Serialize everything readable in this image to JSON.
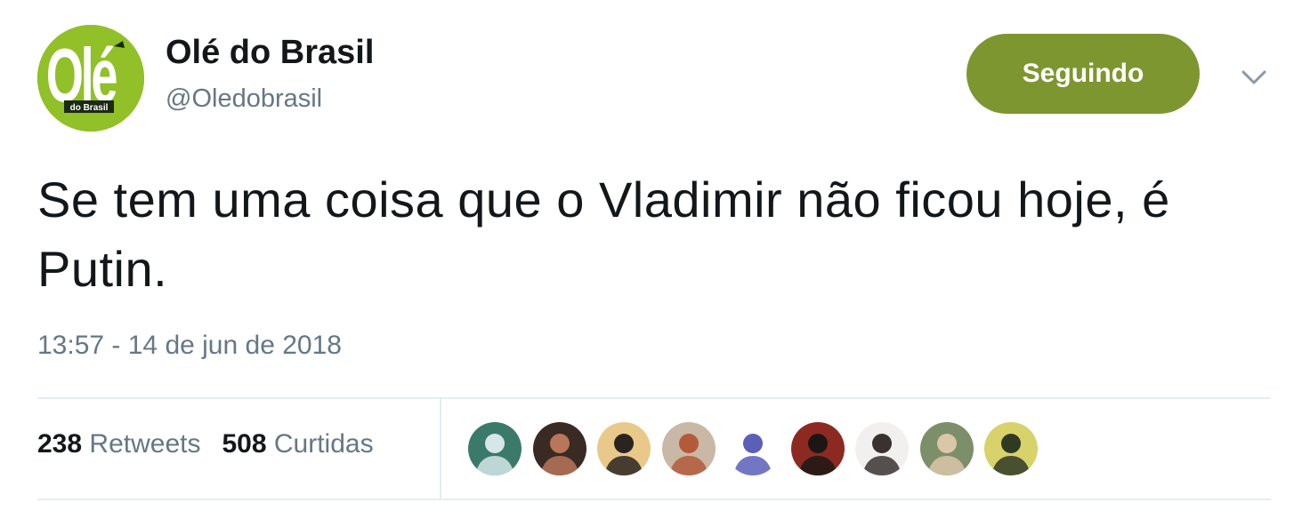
{
  "author": {
    "display_name": "Olé do Brasil",
    "handle": "@Oledobrasil",
    "avatar_text": "Olé",
    "avatar_subtext": "do Brasil"
  },
  "follow_button": {
    "label": "Seguindo"
  },
  "tweet": {
    "text": "Se tem uma coisa que o Vladimir não ficou hoje, é Putin.",
    "timestamp": "13:57 - 14 de jun de 2018"
  },
  "stats": {
    "retweets_count": "238",
    "retweets_label": "Retweets",
    "likes_count": "508",
    "likes_label": "Curtidas"
  },
  "likers": [
    {
      "name": "liker-1",
      "bg": "#3b7a6a",
      "fg": "#d7e6e9"
    },
    {
      "name": "liker-2",
      "bg": "#3a2a24",
      "fg": "#b9765a"
    },
    {
      "name": "liker-3",
      "bg": "#e9c98a",
      "fg": "#2a2320"
    },
    {
      "name": "liker-4",
      "bg": "#c9b8a6",
      "fg": "#b35a3a"
    },
    {
      "name": "liker-5",
      "bg": "#ffffff",
      "fg": "#5a5fb8"
    },
    {
      "name": "liker-6",
      "bg": "#8c2a22",
      "fg": "#1c1715"
    },
    {
      "name": "liker-7",
      "bg": "#f2f0ee",
      "fg": "#3a3230"
    },
    {
      "name": "liker-8",
      "bg": "#7d8f6a",
      "fg": "#d9c7a8"
    },
    {
      "name": "liker-9",
      "bg": "#d8d26a",
      "fg": "#2f3a24"
    }
  ],
  "colors": {
    "accent": "#7e9630",
    "secondary_text": "#657786",
    "primary_text": "#14171a",
    "divider": "#e6ecf0",
    "brand_green": "#8dbb27"
  }
}
